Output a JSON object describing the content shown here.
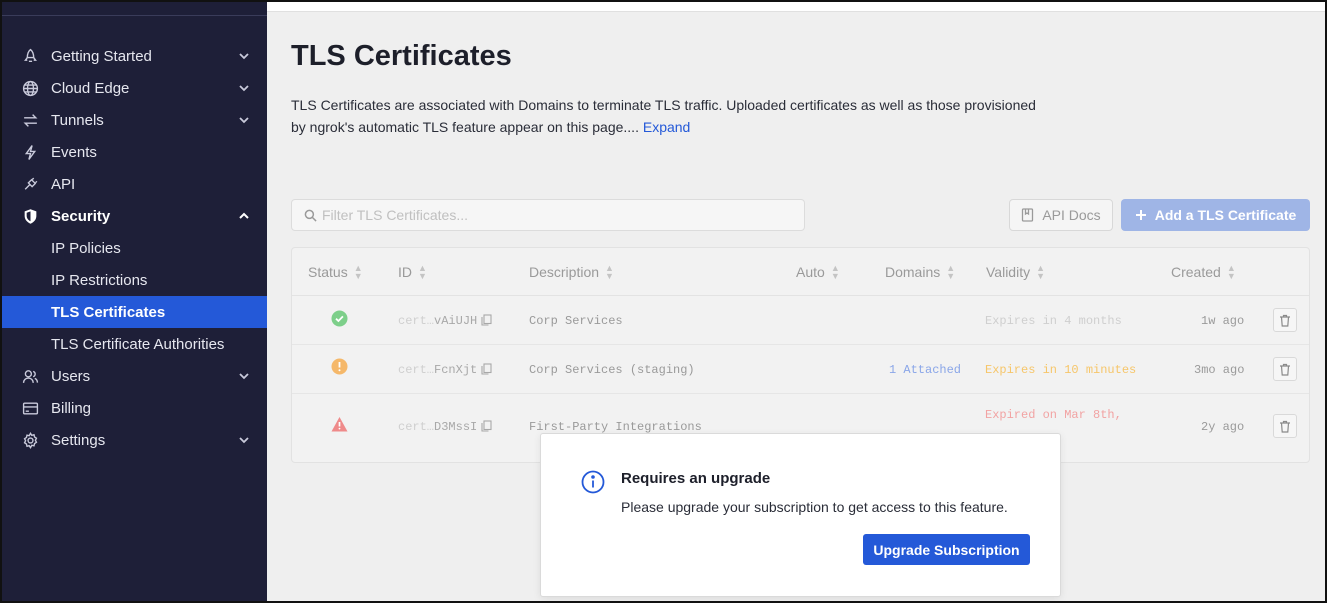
{
  "sidebar": {
    "items": [
      {
        "label": "Getting Started",
        "icon": "rocket-icon",
        "chevron": "down"
      },
      {
        "label": "Cloud Edge",
        "icon": "globe-icon",
        "chevron": "down"
      },
      {
        "label": "Tunnels",
        "icon": "arrows-icon",
        "chevron": "down"
      },
      {
        "label": "Events",
        "icon": "lightning-icon",
        "chevron": ""
      },
      {
        "label": "API",
        "icon": "plug-icon",
        "chevron": ""
      },
      {
        "label": "Security",
        "icon": "shield-icon",
        "chevron": "up"
      },
      {
        "label": "IP Policies",
        "sub": true
      },
      {
        "label": "IP Restrictions",
        "sub": true
      },
      {
        "label": "TLS Certificates",
        "sub": true,
        "active": true
      },
      {
        "label": "TLS Certificate Authorities",
        "sub": true
      },
      {
        "label": "Users",
        "icon": "users-icon",
        "chevron": "down"
      },
      {
        "label": "Billing",
        "icon": "card-icon",
        "chevron": ""
      },
      {
        "label": "Settings",
        "icon": "gear-icon",
        "chevron": "down"
      }
    ]
  },
  "page": {
    "title": "TLS Certificates",
    "description": "TLS Certificates are associated with Domains to terminate TLS traffic. Uploaded certificates as well as those provisioned by ngrok's automatic TLS feature appear on this page....",
    "expand": "Expand"
  },
  "toolbar": {
    "search_placeholder": "Filter TLS Certificates...",
    "api_docs": "API Docs",
    "add_button": "Add a TLS Certificate"
  },
  "table": {
    "headers": [
      "Status",
      "ID",
      "Description",
      "Auto",
      "Domains",
      "Validity",
      "Created"
    ],
    "rows": [
      {
        "status": "ok",
        "id_prefix": "cert…",
        "id_tail": "vAiUJH",
        "description": "Corp Services",
        "domains": "",
        "validity": "Expires in 4 months",
        "validity_color": "#cfcfcf",
        "created": "1w ago"
      },
      {
        "status": "warn",
        "id_prefix": "cert…",
        "id_tail": "FcnXjt",
        "description": "Corp Services (staging)",
        "domains": "1 Attached",
        "validity": "Expires in 10 minutes",
        "validity_color": "#f6c66a",
        "created": "3mo ago"
      },
      {
        "status": "error",
        "id_prefix": "cert…",
        "id_tail": "D3MssI",
        "description": "First-Party Integrations",
        "domains": "",
        "validity": "Expired on Mar 8th,",
        "validity_color": "#f2a3a3",
        "created": "2y ago"
      }
    ]
  },
  "modal": {
    "title": "Requires an upgrade",
    "text": "Please upgrade your subscription to get access to this feature.",
    "button": "Upgrade Subscription"
  },
  "colors": {
    "sidebar_bg": "#1e1f38",
    "accent": "#2459d8",
    "ok": "#7dcf8a",
    "warn": "#f5b86a",
    "error": "#ef8a8a"
  }
}
